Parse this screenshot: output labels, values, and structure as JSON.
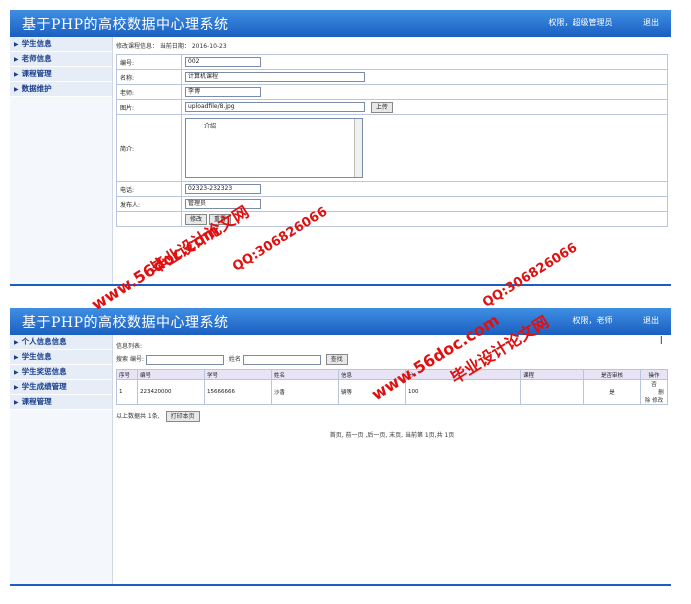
{
  "panel1": {
    "app_title": "基于PHP的高校数据中心理系统",
    "role_text": "权限，超级管理员",
    "logout": "退出",
    "nav": [
      "学生信息",
      "老师信息",
      "课程管理",
      "数据维护"
    ],
    "info": "修改课程信息： 当前日期： 2016-10-23",
    "fields": {
      "id_label": "编号:",
      "id_value": "002",
      "name_label": "名称:",
      "name_value": "计算机课程",
      "teacher_label": "老师:",
      "teacher_value": "李博",
      "image_label": "图片:",
      "image_value": "uploadfile/8.jpg",
      "upload_button": "上传",
      "intro_label": "简介:",
      "intro_value": "介绍",
      "phone_label": "电话:",
      "phone_value": "02323-232323",
      "publisher_label": "发布人:",
      "publisher_value": "管理员"
    },
    "submit_button": "修改",
    "reset_button": "重置"
  },
  "panel2": {
    "app_title": "基于PHP的高校数据中心理系统",
    "role_text": "权限，老师",
    "logout": "退出",
    "nav": [
      "个人信息信息",
      "学生信息",
      "学生奖惩信息",
      "学生成绩管理",
      "课程管理"
    ],
    "list_title": "信息列表:",
    "search_label": "搜索",
    "search_id_label": "编号:",
    "search_name_label": "姓名",
    "search_button": "查找",
    "columns": [
      "序号",
      "编号",
      "学号",
      "姓名",
      "信息",
      "分",
      "课程",
      "是否审核",
      "操作"
    ],
    "rows": [
      [
        "1",
        "223420000",
        "15666666",
        "沙香",
        "辆等",
        "100",
        "",
        "是",
        "否"
      ]
    ],
    "actions": [
      "删除",
      "修改"
    ],
    "summary": "以上数据共 1条,",
    "print_button": "打印本页",
    "pagination": "首页, 前一页 ,后一页, 末页, 当前第 1页,共 1页",
    "cursor": "I"
  },
  "watermarks": {
    "site": "www.56doc.com",
    "brand": "毕业设计论文网",
    "qq": "QQ:306826066"
  }
}
